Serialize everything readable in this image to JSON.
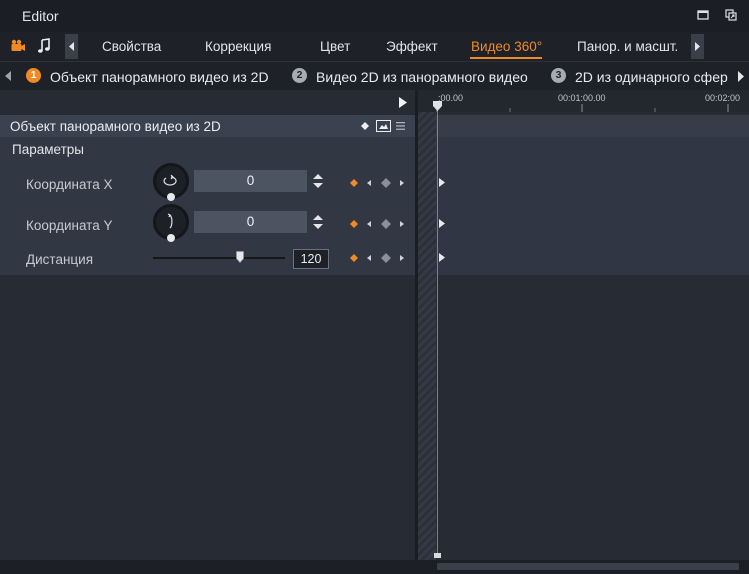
{
  "window": {
    "title": "Editor"
  },
  "tabs": {
    "items": [
      "Свойства",
      "Коррекция",
      "Цвет",
      "Эффект",
      "Видео 360°",
      "Панор. и масшт."
    ],
    "active": "Видео 360°"
  },
  "steps": [
    {
      "num": "1",
      "label": "Объект панорамного видео из 2D"
    },
    {
      "num": "2",
      "label": "Видео 2D из панорамного видео"
    },
    {
      "num": "3",
      "label": "2D из одинарного сфер"
    }
  ],
  "section": {
    "title": "Объект панорамного видео из 2D"
  },
  "params": {
    "title": "Параметры",
    "coord_x": {
      "label": "Координата X",
      "value": "0"
    },
    "coord_y": {
      "label": "Координата Y",
      "value": "0"
    },
    "distance": {
      "label": "Дистанция",
      "value": "120"
    }
  },
  "timeline": {
    "ruler": [
      ":00.00",
      "00:01:00.00",
      "00:02:00"
    ]
  },
  "colors": {
    "accent": "#f08a24",
    "playhead": "#e2602a",
    "header": "#3a414f"
  },
  "icons": [
    "video-icon",
    "music-icon",
    "restore-icon",
    "popout-icon",
    "keyframe-add-icon",
    "compare-icon",
    "menu-icon",
    "play-icon"
  ]
}
